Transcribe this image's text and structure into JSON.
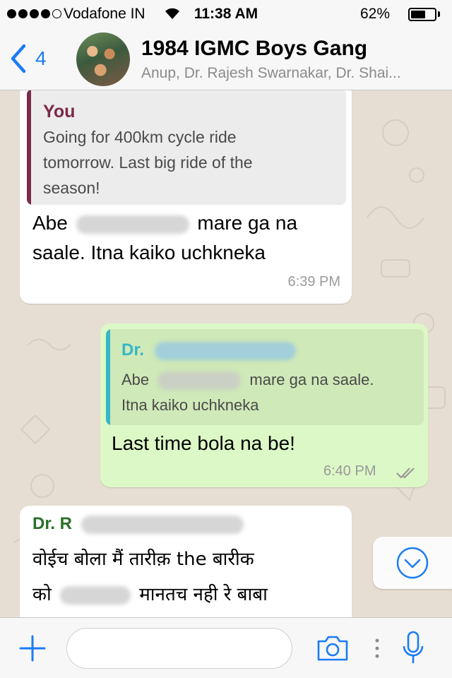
{
  "status_bar": {
    "carrier": "Vodafone IN",
    "time": "11:38 AM",
    "battery_percent": "62%",
    "battery_level": 0.62,
    "signal_bars": 4
  },
  "header": {
    "back_count": "4",
    "title": "1984 IGMC Boys Gang",
    "subtitle": "Anup, Dr. Rajesh Swarnakar, Dr. Shai..."
  },
  "messages": [
    {
      "direction": "incoming",
      "quote": {
        "author": "You",
        "text_line1": "Going for 400km cycle ride",
        "text_line2": "tomorrow. Last big ride of the",
        "text_line3": "season!"
      },
      "text_part1": "Abe",
      "text_part2": "mare ga na",
      "text_line2": "saale. Itna kaiko uchkneka",
      "time": "6:39 PM"
    },
    {
      "direction": "outgoing",
      "quote": {
        "author": "Dr.",
        "text_part1": "Abe",
        "text_part2": "mare ga na saale.",
        "text_line2": "Itna kaiko uchkneka"
      },
      "text": "Last time bola na be!",
      "time": "6:40 PM",
      "status": "read"
    },
    {
      "direction": "incoming",
      "sender": "Dr. R",
      "text_line1": "वोईच बोला मैं तारीक़ the बारीक",
      "text_line2a": "को",
      "text_line2b": "मानतच नही रे बाबा"
    }
  ],
  "colors": {
    "accent": "#1a7cf5",
    "outgoing_bubble": "#dcf8c6",
    "incoming_bubble": "#ffffff",
    "you_quote_bar": "#7a2a4a",
    "dr_quote_bar": "#35b7c7",
    "sender_name": "#2a6f2a"
  },
  "icons": {
    "back": "chevron-left-icon",
    "scroll_down": "chevron-down-circle-icon",
    "attach": "plus-icon",
    "camera": "camera-icon",
    "more": "vertical-dots-icon",
    "mic": "microphone-icon"
  }
}
